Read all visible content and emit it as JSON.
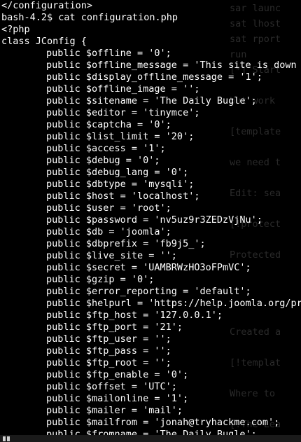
{
  "terminal": {
    "lines": [
      {
        "indent": false,
        "text": "</configuration>"
      },
      {
        "indent": false,
        "text": "bash-4.2$ cat configuration.php"
      },
      {
        "indent": false,
        "text": "<?php"
      },
      {
        "indent": false,
        "text": "class JConfig {"
      },
      {
        "indent": true,
        "text": "public $offline = '0';"
      },
      {
        "indent": true,
        "text": "public $offline_message = 'This site is down f"
      },
      {
        "indent": true,
        "text": "public $display_offline_message = '1';"
      },
      {
        "indent": true,
        "text": "public $offline_image = '';"
      },
      {
        "indent": true,
        "text": "public $sitename = 'The Daily Bugle';"
      },
      {
        "indent": true,
        "text": "public $editor = 'tinymce';"
      },
      {
        "indent": true,
        "text": "public $captcha = '0';"
      },
      {
        "indent": true,
        "text": "public $list_limit = '20';"
      },
      {
        "indent": true,
        "text": "public $access = '1';"
      },
      {
        "indent": true,
        "text": "public $debug = '0';"
      },
      {
        "indent": true,
        "text": "public $debug_lang = '0';"
      },
      {
        "indent": true,
        "text": "public $dbtype = 'mysqli';"
      },
      {
        "indent": true,
        "text": "public $host = 'localhost';"
      },
      {
        "indent": true,
        "text": "public $user = 'root';"
      },
      {
        "indent": true,
        "text": "public $password = 'nv5uz9r3ZEDzVjNu';"
      },
      {
        "indent": true,
        "text": "public $db = 'joomla';"
      },
      {
        "indent": true,
        "text": "public $dbprefix = 'fb9j5_';"
      },
      {
        "indent": true,
        "text": "public $live_site = '';"
      },
      {
        "indent": true,
        "text": "public $secret = 'UAMBRWzHO3oFPmVC';"
      },
      {
        "indent": true,
        "text": "public $gzip = '0';"
      },
      {
        "indent": true,
        "text": "public $error_reporting = 'default';"
      },
      {
        "indent": true,
        "text": "public $helpurl = 'https://help.joomla.org/pro"
      },
      {
        "indent": true,
        "text": "public $ftp_host = '127.0.0.1';"
      },
      {
        "indent": true,
        "text": "public $ftp_port = '21';"
      },
      {
        "indent": true,
        "text": "public $ftp_user = '';"
      },
      {
        "indent": true,
        "text": "public $ftp_pass = '';"
      },
      {
        "indent": true,
        "text": "public $ftp_root = '';"
      },
      {
        "indent": true,
        "text": "public $ftp_enable = '0';"
      },
      {
        "indent": true,
        "text": "public $offset = 'UTC';"
      },
      {
        "indent": true,
        "text": "public $mailonline = '1';"
      },
      {
        "indent": true,
        "text": "public $mailer = 'mail';"
      },
      {
        "indent": true,
        "text": "public $mailfrom = 'jonah@tryhackme.com';"
      },
      {
        "indent": true,
        "text": "public $fromname = 'The Daily Bugle';"
      }
    ]
  },
  "background_ghost": [
    "sar launc",
    "sat lhost",
    "sat rport",
    "run",
    "[*] Start",
    "",
    "but work",
    "",
    "[template",
    "",
    "we need t",
    "",
    "Edit: sea",
    "",
    "[!protect",
    "",
    "Protected",
    "",
    "",
    "",
    "",
    "Created a",
    "",
    "[!templat",
    "",
    "Where to",
    "",
    "[!The Lea"
  ],
  "colors": {
    "background": "#000000",
    "text": "#ffffff",
    "ghost_text": "#2a2a2a",
    "bottom_bar": "#1a1a1a"
  }
}
